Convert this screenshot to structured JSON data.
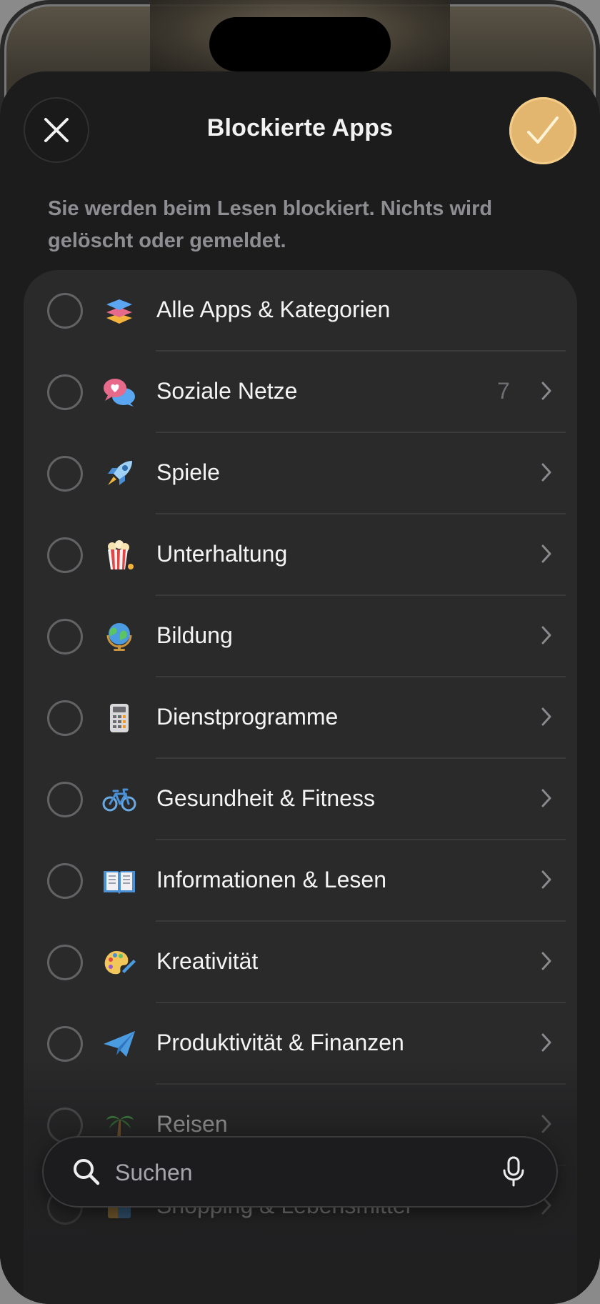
{
  "header": {
    "title": "Blockierte Apps",
    "close_icon": "close-icon",
    "confirm_icon": "checkmark-icon"
  },
  "subtitle": "Sie werden beim Lesen blockiert. Nichts wird gelöscht oder gemeldet.",
  "categories": [
    {
      "label": "Alle Apps & Kategorien",
      "icon": "stack-icon",
      "count": "",
      "has_chevron": false
    },
    {
      "label": "Soziale Netze",
      "icon": "speech-bubbles-icon",
      "count": "7",
      "has_chevron": true
    },
    {
      "label": "Spiele",
      "icon": "rocket-icon",
      "count": "",
      "has_chevron": true
    },
    {
      "label": "Unterhaltung",
      "icon": "popcorn-icon",
      "count": "",
      "has_chevron": true
    },
    {
      "label": "Bildung",
      "icon": "globe-icon",
      "count": "",
      "has_chevron": true
    },
    {
      "label": "Dienstprogramme",
      "icon": "calculator-icon",
      "count": "",
      "has_chevron": true
    },
    {
      "label": "Gesundheit & Fitness",
      "icon": "bicycle-icon",
      "count": "",
      "has_chevron": true
    },
    {
      "label": "Informationen & Lesen",
      "icon": "book-icon",
      "count": "",
      "has_chevron": true
    },
    {
      "label": "Kreativität",
      "icon": "palette-icon",
      "count": "",
      "has_chevron": true
    },
    {
      "label": "Produktivität & Finanzen",
      "icon": "paper-plane-icon",
      "count": "",
      "has_chevron": true
    },
    {
      "label": "Reisen",
      "icon": "palm-tree-icon",
      "count": "",
      "has_chevron": true
    },
    {
      "label": "Shopping & Lebensmittel",
      "icon": "shopping-icon",
      "count": "",
      "has_chevron": true
    }
  ],
  "search": {
    "placeholder": "Suchen",
    "value": "",
    "search_icon": "search-icon",
    "mic_icon": "microphone-icon"
  },
  "colors": {
    "accent": "#e3b670",
    "sheet_background": "#1c1c1d",
    "list_background": "#2a2a2b"
  }
}
